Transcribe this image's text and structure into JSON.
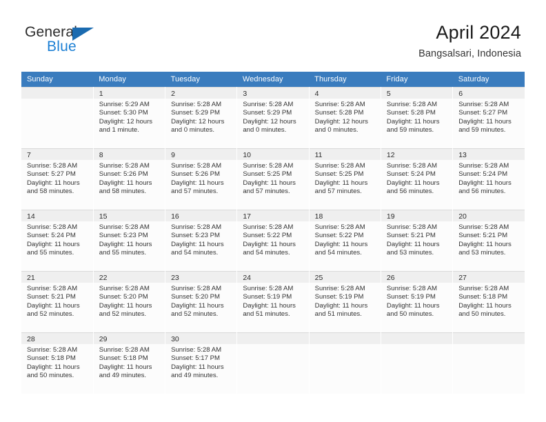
{
  "brand": {
    "name_part1": "General",
    "name_part2": "Blue",
    "triangle_icon": "triangle-icon",
    "accent_color": "#1b7fd4"
  },
  "header": {
    "title": "April 2024",
    "subtitle": "Bangsalsari, Indonesia"
  },
  "theme": {
    "header_row_bg": "#3a7cbe",
    "day_band_bg": "#efefef",
    "grid_line": "#d9d9d9",
    "text_color": "#333333"
  },
  "weekdays": [
    "Sunday",
    "Monday",
    "Tuesday",
    "Wednesday",
    "Thursday",
    "Friday",
    "Saturday"
  ],
  "labels": {
    "sunrise": "Sunrise:",
    "sunset": "Sunset:",
    "daylight": "Daylight:"
  },
  "weeks": [
    [
      {
        "day": "",
        "sunrise": "",
        "sunset": "",
        "daylight": "",
        "blank": true
      },
      {
        "day": "1",
        "sunrise": "Sunrise: 5:29 AM",
        "sunset": "Sunset: 5:30 PM",
        "daylight": "Daylight: 12 hours and 1 minute."
      },
      {
        "day": "2",
        "sunrise": "Sunrise: 5:28 AM",
        "sunset": "Sunset: 5:29 PM",
        "daylight": "Daylight: 12 hours and 0 minutes."
      },
      {
        "day": "3",
        "sunrise": "Sunrise: 5:28 AM",
        "sunset": "Sunset: 5:29 PM",
        "daylight": "Daylight: 12 hours and 0 minutes."
      },
      {
        "day": "4",
        "sunrise": "Sunrise: 5:28 AM",
        "sunset": "Sunset: 5:28 PM",
        "daylight": "Daylight: 12 hours and 0 minutes."
      },
      {
        "day": "5",
        "sunrise": "Sunrise: 5:28 AM",
        "sunset": "Sunset: 5:28 PM",
        "daylight": "Daylight: 11 hours and 59 minutes."
      },
      {
        "day": "6",
        "sunrise": "Sunrise: 5:28 AM",
        "sunset": "Sunset: 5:27 PM",
        "daylight": "Daylight: 11 hours and 59 minutes."
      }
    ],
    [
      {
        "day": "7",
        "sunrise": "Sunrise: 5:28 AM",
        "sunset": "Sunset: 5:27 PM",
        "daylight": "Daylight: 11 hours and 58 minutes."
      },
      {
        "day": "8",
        "sunrise": "Sunrise: 5:28 AM",
        "sunset": "Sunset: 5:26 PM",
        "daylight": "Daylight: 11 hours and 58 minutes."
      },
      {
        "day": "9",
        "sunrise": "Sunrise: 5:28 AM",
        "sunset": "Sunset: 5:26 PM",
        "daylight": "Daylight: 11 hours and 57 minutes."
      },
      {
        "day": "10",
        "sunrise": "Sunrise: 5:28 AM",
        "sunset": "Sunset: 5:25 PM",
        "daylight": "Daylight: 11 hours and 57 minutes."
      },
      {
        "day": "11",
        "sunrise": "Sunrise: 5:28 AM",
        "sunset": "Sunset: 5:25 PM",
        "daylight": "Daylight: 11 hours and 57 minutes."
      },
      {
        "day": "12",
        "sunrise": "Sunrise: 5:28 AM",
        "sunset": "Sunset: 5:24 PM",
        "daylight": "Daylight: 11 hours and 56 minutes."
      },
      {
        "day": "13",
        "sunrise": "Sunrise: 5:28 AM",
        "sunset": "Sunset: 5:24 PM",
        "daylight": "Daylight: 11 hours and 56 minutes."
      }
    ],
    [
      {
        "day": "14",
        "sunrise": "Sunrise: 5:28 AM",
        "sunset": "Sunset: 5:24 PM",
        "daylight": "Daylight: 11 hours and 55 minutes."
      },
      {
        "day": "15",
        "sunrise": "Sunrise: 5:28 AM",
        "sunset": "Sunset: 5:23 PM",
        "daylight": "Daylight: 11 hours and 55 minutes."
      },
      {
        "day": "16",
        "sunrise": "Sunrise: 5:28 AM",
        "sunset": "Sunset: 5:23 PM",
        "daylight": "Daylight: 11 hours and 54 minutes."
      },
      {
        "day": "17",
        "sunrise": "Sunrise: 5:28 AM",
        "sunset": "Sunset: 5:22 PM",
        "daylight": "Daylight: 11 hours and 54 minutes."
      },
      {
        "day": "18",
        "sunrise": "Sunrise: 5:28 AM",
        "sunset": "Sunset: 5:22 PM",
        "daylight": "Daylight: 11 hours and 54 minutes."
      },
      {
        "day": "19",
        "sunrise": "Sunrise: 5:28 AM",
        "sunset": "Sunset: 5:21 PM",
        "daylight": "Daylight: 11 hours and 53 minutes."
      },
      {
        "day": "20",
        "sunrise": "Sunrise: 5:28 AM",
        "sunset": "Sunset: 5:21 PM",
        "daylight": "Daylight: 11 hours and 53 minutes."
      }
    ],
    [
      {
        "day": "21",
        "sunrise": "Sunrise: 5:28 AM",
        "sunset": "Sunset: 5:21 PM",
        "daylight": "Daylight: 11 hours and 52 minutes."
      },
      {
        "day": "22",
        "sunrise": "Sunrise: 5:28 AM",
        "sunset": "Sunset: 5:20 PM",
        "daylight": "Daylight: 11 hours and 52 minutes."
      },
      {
        "day": "23",
        "sunrise": "Sunrise: 5:28 AM",
        "sunset": "Sunset: 5:20 PM",
        "daylight": "Daylight: 11 hours and 52 minutes."
      },
      {
        "day": "24",
        "sunrise": "Sunrise: 5:28 AM",
        "sunset": "Sunset: 5:19 PM",
        "daylight": "Daylight: 11 hours and 51 minutes."
      },
      {
        "day": "25",
        "sunrise": "Sunrise: 5:28 AM",
        "sunset": "Sunset: 5:19 PM",
        "daylight": "Daylight: 11 hours and 51 minutes."
      },
      {
        "day": "26",
        "sunrise": "Sunrise: 5:28 AM",
        "sunset": "Sunset: 5:19 PM",
        "daylight": "Daylight: 11 hours and 50 minutes."
      },
      {
        "day": "27",
        "sunrise": "Sunrise: 5:28 AM",
        "sunset": "Sunset: 5:18 PM",
        "daylight": "Daylight: 11 hours and 50 minutes."
      }
    ],
    [
      {
        "day": "28",
        "sunrise": "Sunrise: 5:28 AM",
        "sunset": "Sunset: 5:18 PM",
        "daylight": "Daylight: 11 hours and 50 minutes."
      },
      {
        "day": "29",
        "sunrise": "Sunrise: 5:28 AM",
        "sunset": "Sunset: 5:18 PM",
        "daylight": "Daylight: 11 hours and 49 minutes."
      },
      {
        "day": "30",
        "sunrise": "Sunrise: 5:28 AM",
        "sunset": "Sunset: 5:17 PM",
        "daylight": "Daylight: 11 hours and 49 minutes."
      },
      {
        "day": "",
        "sunrise": "",
        "sunset": "",
        "daylight": "",
        "blank": true
      },
      {
        "day": "",
        "sunrise": "",
        "sunset": "",
        "daylight": "",
        "blank": true
      },
      {
        "day": "",
        "sunrise": "",
        "sunset": "",
        "daylight": "",
        "blank": true
      },
      {
        "day": "",
        "sunrise": "",
        "sunset": "",
        "daylight": "",
        "blank": true
      }
    ]
  ]
}
